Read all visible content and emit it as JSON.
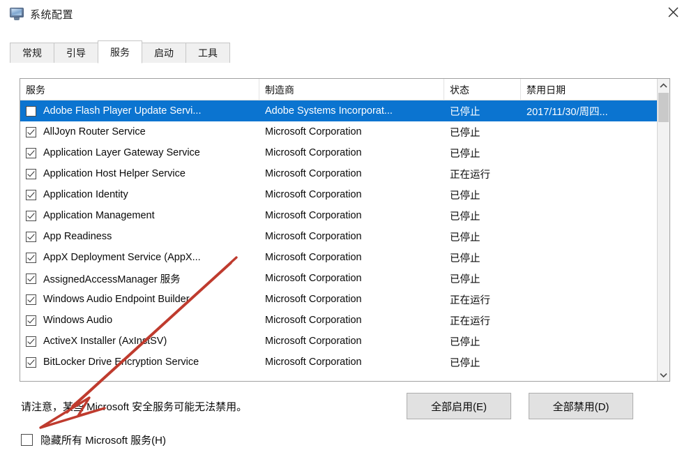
{
  "window": {
    "title": "系统配置",
    "icon": "system-configuration-monitor-icon",
    "close_label": "✕"
  },
  "tabs": [
    {
      "label": "常规",
      "active": false
    },
    {
      "label": "引导",
      "active": false
    },
    {
      "label": "服务",
      "active": true
    },
    {
      "label": "启动",
      "active": false
    },
    {
      "label": "工具",
      "active": false
    }
  ],
  "services_table": {
    "columns": [
      {
        "key": "name",
        "label": "服务"
      },
      {
        "key": "maker",
        "label": "制造商"
      },
      {
        "key": "status",
        "label": "状态"
      },
      {
        "key": "date",
        "label": "禁用日期"
      }
    ],
    "rows": [
      {
        "checked": false,
        "selected": true,
        "name": "Adobe Flash Player Update Servi...",
        "maker": "Adobe Systems Incorporat...",
        "status": "已停止",
        "date": "2017/11/30/周四..."
      },
      {
        "checked": true,
        "selected": false,
        "name": "AllJoyn Router Service",
        "maker": "Microsoft Corporation",
        "status": "已停止",
        "date": ""
      },
      {
        "checked": true,
        "selected": false,
        "name": "Application Layer Gateway Service",
        "maker": "Microsoft Corporation",
        "status": "已停止",
        "date": ""
      },
      {
        "checked": true,
        "selected": false,
        "name": "Application Host Helper Service",
        "maker": "Microsoft Corporation",
        "status": "正在运行",
        "date": ""
      },
      {
        "checked": true,
        "selected": false,
        "name": "Application Identity",
        "maker": "Microsoft Corporation",
        "status": "已停止",
        "date": ""
      },
      {
        "checked": true,
        "selected": false,
        "name": "Application Management",
        "maker": "Microsoft Corporation",
        "status": "已停止",
        "date": ""
      },
      {
        "checked": true,
        "selected": false,
        "name": "App Readiness",
        "maker": "Microsoft Corporation",
        "status": "已停止",
        "date": ""
      },
      {
        "checked": true,
        "selected": false,
        "name": "AppX Deployment Service (AppX...",
        "maker": "Microsoft Corporation",
        "status": "已停止",
        "date": ""
      },
      {
        "checked": true,
        "selected": false,
        "name": "AssignedAccessManager 服务",
        "maker": "Microsoft Corporation",
        "status": "已停止",
        "date": ""
      },
      {
        "checked": true,
        "selected": false,
        "name": "Windows Audio Endpoint Builder",
        "maker": "Microsoft Corporation",
        "status": "正在运行",
        "date": ""
      },
      {
        "checked": true,
        "selected": false,
        "name": "Windows Audio",
        "maker": "Microsoft Corporation",
        "status": "正在运行",
        "date": ""
      },
      {
        "checked": true,
        "selected": false,
        "name": "ActiveX Installer (AxInstSV)",
        "maker": "Microsoft Corporation",
        "status": "已停止",
        "date": ""
      },
      {
        "checked": true,
        "selected": false,
        "name": "BitLocker Drive Encryption Service",
        "maker": "Microsoft Corporation",
        "status": "已停止",
        "date": ""
      }
    ]
  },
  "scrollbar": {
    "up_arrow": "chevron-up-icon",
    "down_arrow": "chevron-down-icon"
  },
  "footer": {
    "note": "请注意，某些 Microsoft 安全服务可能无法禁用。",
    "hide_microsoft_label": "隐藏所有 Microsoft 服务(H)",
    "hide_microsoft_checked": false,
    "enable_all_label": "全部启用(E)",
    "disable_all_label": "全部禁用(D)"
  },
  "annotation": {
    "type": "hand-drawn-arrow",
    "color": "#c0392b",
    "points_to": "隐藏所有 Microsoft 服务(H)"
  },
  "colors": {
    "selection_blue": "#0b74d0",
    "annotation_red": "#c0392b",
    "button_face": "#e1e1e1",
    "tab_inactive": "#f0f0f0"
  }
}
